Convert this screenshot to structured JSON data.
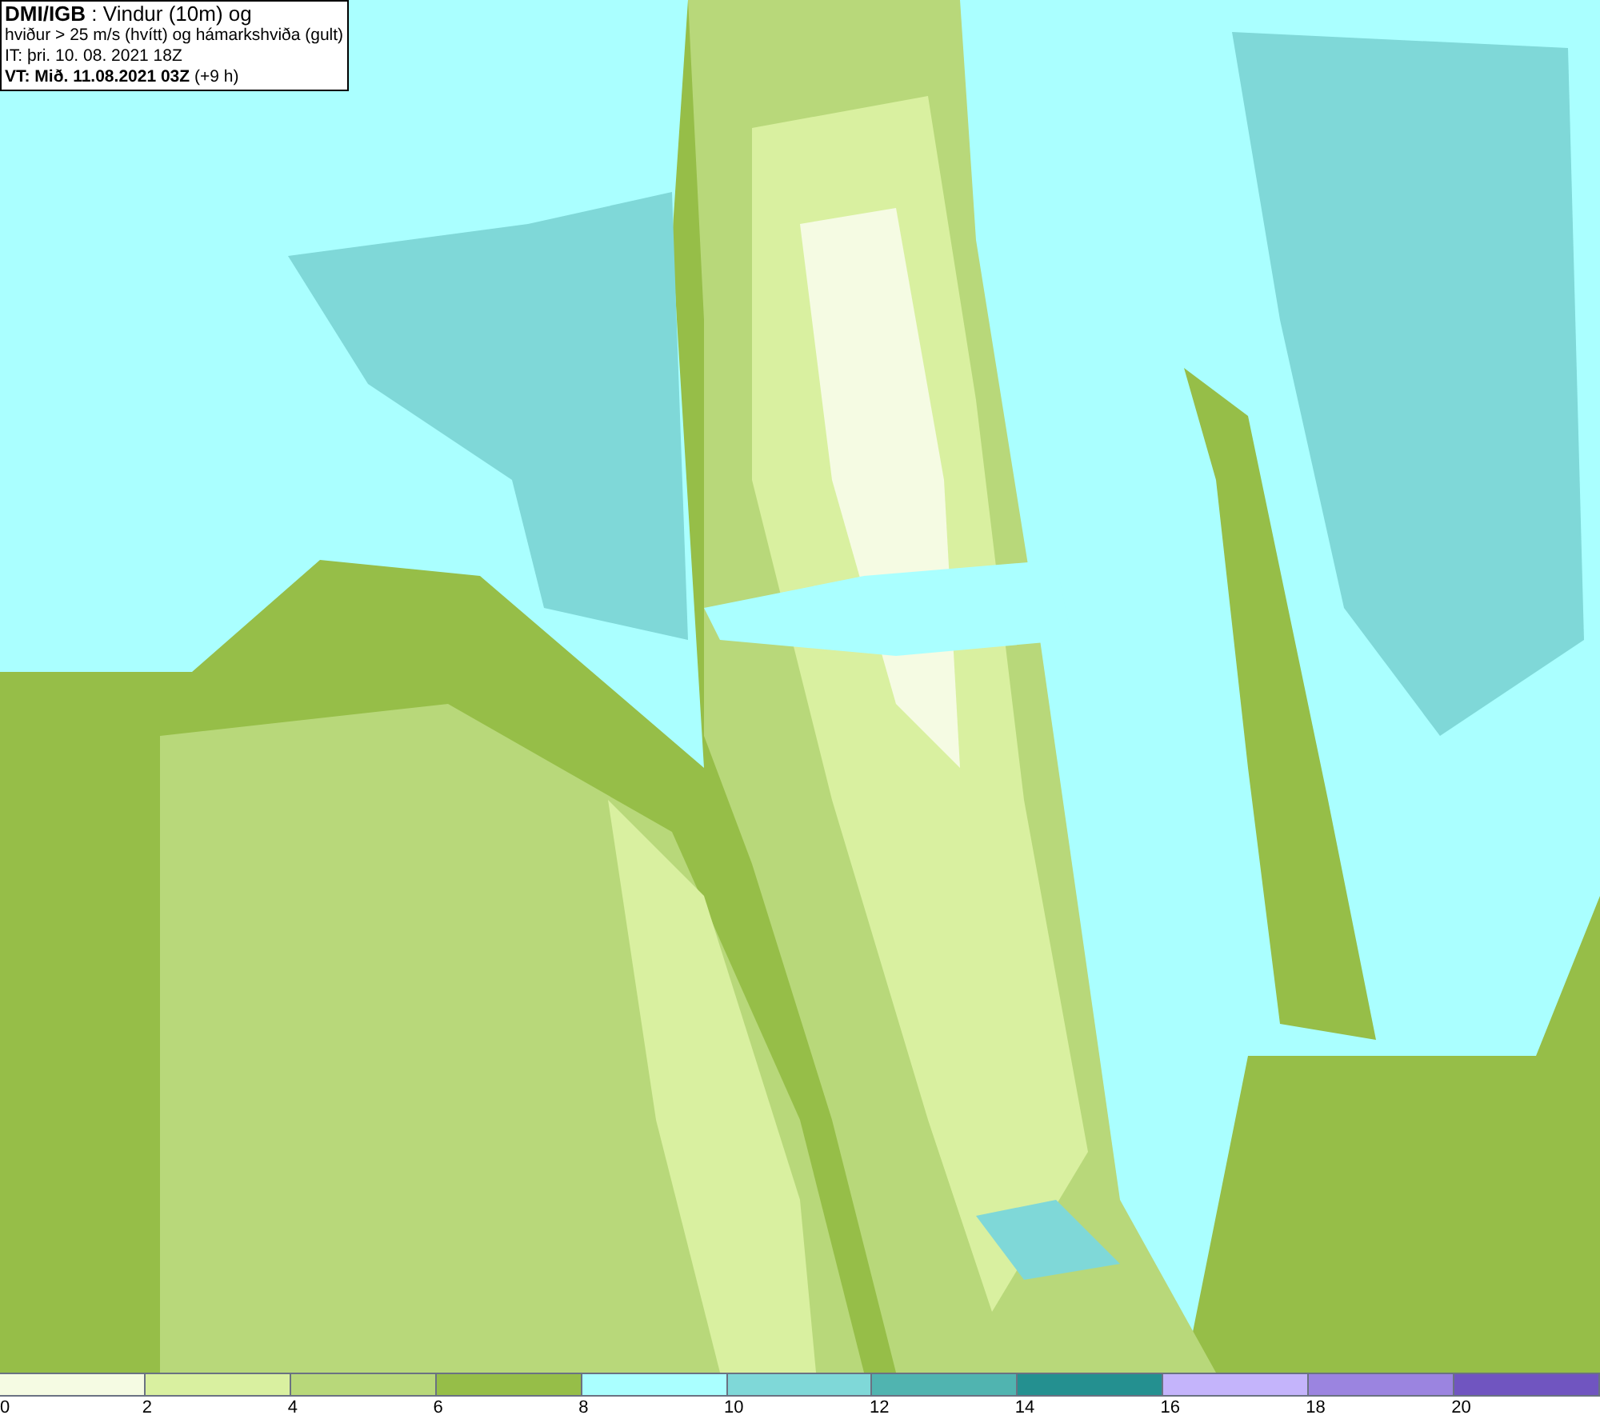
{
  "info_box": {
    "lines": [
      "**DMI/IGB** : Vindur (10m) og",
      "hviður > 25 m/s (hvítt) og hámarkshviða (gult)",
      "IT: þri. 10. 08. 2021 18Z",
      "**VT: Mið. 11.08.2021 03Z** (+9 h)"
    ]
  },
  "legend": {
    "segments": [
      {
        "label": "0",
        "color": "#f5fbe3"
      },
      {
        "label": "2",
        "color": "#d9f0a0"
      },
      {
        "label": "4",
        "color": "#b8d87a"
      },
      {
        "label": "6",
        "color": "#96be48"
      },
      {
        "label": "8",
        "color": "#aaffff"
      },
      {
        "label": "10",
        "color": "#7fd8d8"
      },
      {
        "label": "12",
        "color": "#50b4b0"
      },
      {
        "label": "14",
        "color": "#249090"
      },
      {
        "label": "16",
        "color": "#c4b4fb"
      },
      {
        "label": "18",
        "color": "#9b84e0"
      },
      {
        "label": "20",
        "color": "#7055c0"
      }
    ]
  }
}
